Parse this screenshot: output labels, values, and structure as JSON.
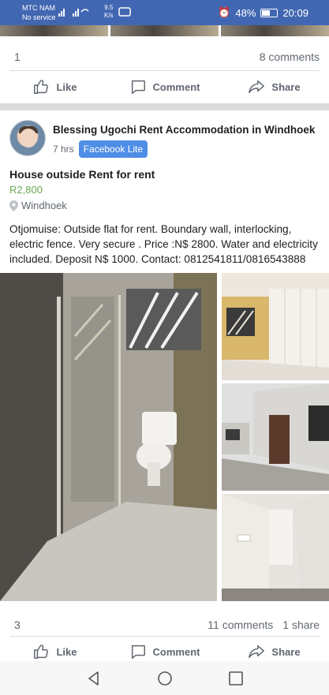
{
  "status_bar": {
    "carrier": "MTC NAM",
    "carrier_sub": "No service",
    "speed_value": "9.5",
    "speed_unit": "K/s",
    "battery": "48%",
    "time": "20:09"
  },
  "previous_post": {
    "reactions": "1",
    "comments": "8 comments"
  },
  "actions": {
    "like": "Like",
    "comment": "Comment",
    "share": "Share"
  },
  "post": {
    "author": "Blessing Ugochi Rent Accommodation in Windhoek",
    "time": "7 hrs",
    "app_badge": "Facebook Lite",
    "title": "House outside Rent for rent",
    "price": "R2,800",
    "location": "Windhoek",
    "description": "Otjomuise: Outside flat for rent. Boundary wall, interlocking, electric fence. Very secure . Price :N$ 2800. Water and electricity included. Deposit N$ 1000. Contact: 0812541811/0816543888",
    "reactions": "3",
    "comments": "11 comments",
    "shares": "1 share"
  },
  "icons": [
    "thumbs-up-icon",
    "comment-icon",
    "share-icon",
    "location-pin-icon",
    "back-icon",
    "home-icon",
    "recents-icon"
  ],
  "colors": {
    "brand": "#4267b2",
    "badge": "#4f8de6",
    "price": "#6aa84f",
    "muted": "#606770"
  }
}
